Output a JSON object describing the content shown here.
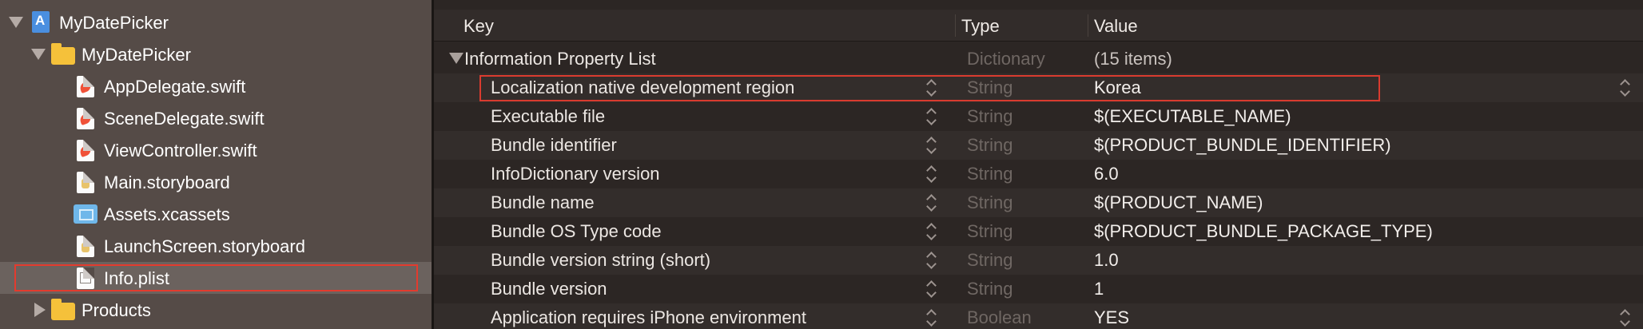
{
  "navigator": {
    "items": [
      {
        "label": "MyDatePicker",
        "kind": "project",
        "disclosure": "expanded"
      },
      {
        "label": "MyDatePicker",
        "kind": "folder",
        "disclosure": "expanded"
      },
      {
        "label": "AppDelegate.swift",
        "kind": "swift"
      },
      {
        "label": "SceneDelegate.swift",
        "kind": "swift"
      },
      {
        "label": "ViewController.swift",
        "kind": "swift"
      },
      {
        "label": "Main.storyboard",
        "kind": "storyboard"
      },
      {
        "label": "Assets.xcassets",
        "kind": "assets"
      },
      {
        "label": "LaunchScreen.storyboard",
        "kind": "storyboard"
      },
      {
        "label": "Info.plist",
        "kind": "plist",
        "selected": true
      },
      {
        "label": "Products",
        "kind": "folder",
        "disclosure": "collapsed"
      }
    ]
  },
  "editor": {
    "columns": {
      "key": "Key",
      "type": "Type",
      "value": "Value"
    },
    "root": {
      "key": "Information Property List",
      "type": "Dictionary",
      "value": "(15 items)"
    },
    "rows": [
      {
        "key": "Localization native development region",
        "type": "String",
        "value": "Korea"
      },
      {
        "key": "Executable file",
        "type": "String",
        "value": "$(EXECUTABLE_NAME)"
      },
      {
        "key": "Bundle identifier",
        "type": "String",
        "value": "$(PRODUCT_BUNDLE_IDENTIFIER)"
      },
      {
        "key": "InfoDictionary version",
        "type": "String",
        "value": "6.0"
      },
      {
        "key": "Bundle name",
        "type": "String",
        "value": "$(PRODUCT_NAME)"
      },
      {
        "key": "Bundle OS Type code",
        "type": "String",
        "value": "$(PRODUCT_BUNDLE_PACKAGE_TYPE)"
      },
      {
        "key": "Bundle version string (short)",
        "type": "String",
        "value": "1.0"
      },
      {
        "key": "Bundle version",
        "type": "String",
        "value": "1"
      },
      {
        "key": "Application requires iPhone environment",
        "type": "Boolean",
        "value": "YES"
      }
    ]
  },
  "colors": {
    "highlight_outline": "#e33b2e",
    "navigator_bg": "#554b47",
    "editor_bg": "#2c2624"
  }
}
